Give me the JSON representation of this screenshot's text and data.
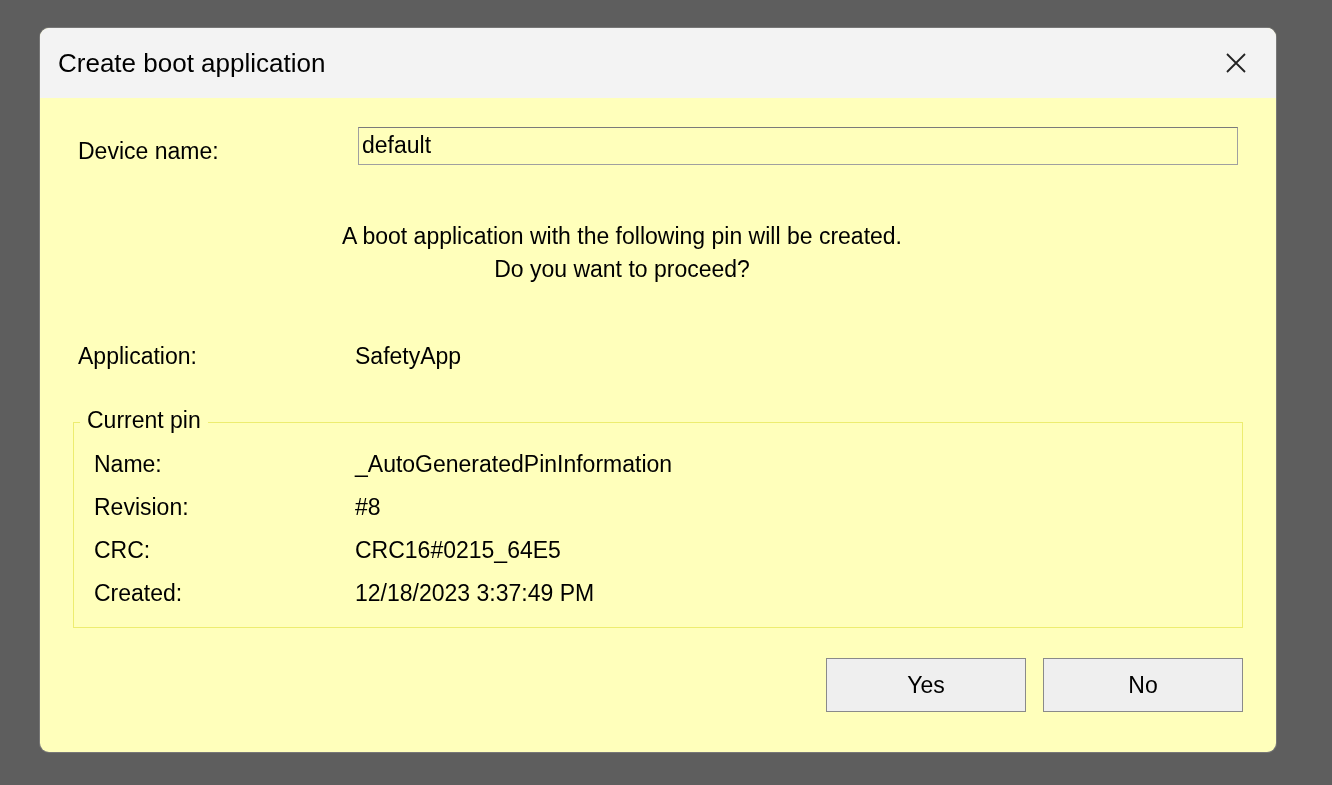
{
  "window": {
    "title": "Create boot application"
  },
  "device_name": {
    "label": "Device name:",
    "value": "default"
  },
  "message": [
    "A boot application with the following pin will be created.",
    "Do you want to proceed?"
  ],
  "application": {
    "label": "Application:",
    "value": "SafetyApp"
  },
  "current_pin": {
    "title": "Current pin",
    "rows": [
      {
        "label": "Name:",
        "value": "_AutoGeneratedPinInformation"
      },
      {
        "label": "Revision:",
        "value": "#8"
      },
      {
        "label": "CRC:",
        "value": "CRC16#0215_64E5"
      },
      {
        "label": "Created:",
        "value": "12/18/2023 3:37:49 PM"
      }
    ]
  },
  "buttons": [
    "Yes",
    "No"
  ]
}
